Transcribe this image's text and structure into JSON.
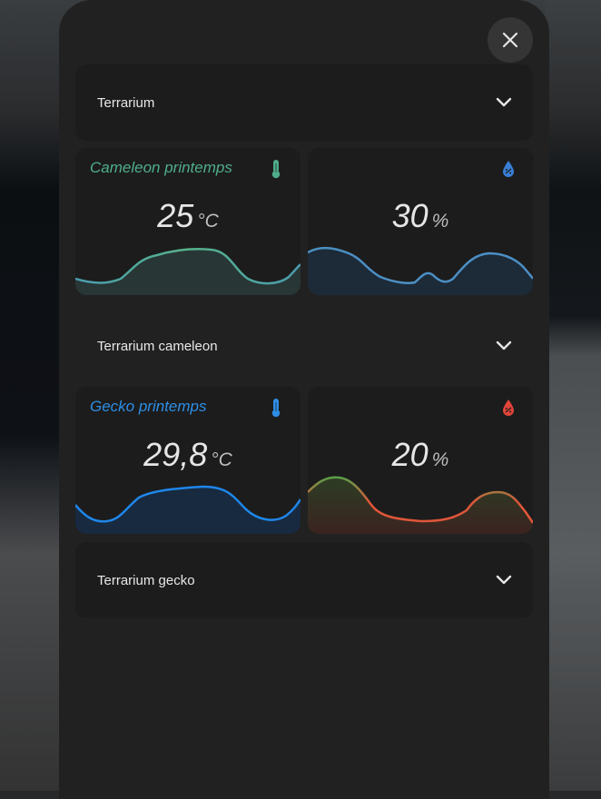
{
  "groups": [
    {
      "title": "Terrarium"
    },
    {
      "title": "Terrarium cameleon"
    },
    {
      "title": "Terrarium gecko"
    }
  ],
  "sensors": [
    {
      "name": "Cameleon printemps",
      "name_color": "#4fae8a",
      "icon": "thermometer-icon",
      "icon_color": "#4fae8a",
      "value": "25",
      "unit": "°C"
    },
    {
      "name": "",
      "icon": "water-drop-icon",
      "icon_color": "#3a7fd6",
      "value": "30",
      "unit": "%"
    },
    {
      "name": "Gecko printemps",
      "name_color": "#2d8ee6",
      "icon": "thermometer-icon",
      "icon_color": "#2d8ee6",
      "value": "29,8",
      "unit": "°C"
    },
    {
      "name": "",
      "icon": "water-drop-icon",
      "icon_color": "#e0453a",
      "value": "20",
      "unit": "%"
    }
  ]
}
